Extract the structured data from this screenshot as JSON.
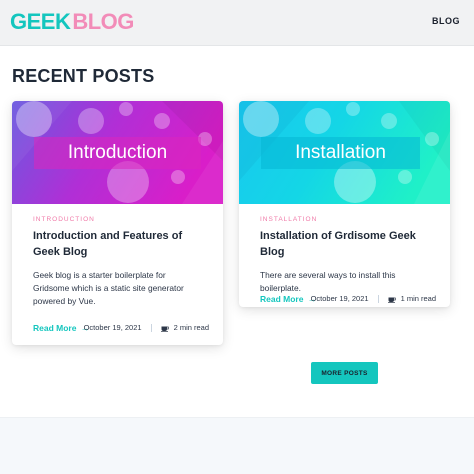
{
  "header": {
    "logo_part1": "GEEK",
    "logo_part2": "BLOG",
    "nav_blog": "BLOG"
  },
  "section_title": "RECENT POSTS",
  "posts": [
    {
      "thumb_label": "Introduction",
      "tag": "INTRODUCTION",
      "title": "Introduction and Features of Geek Blog",
      "excerpt": "Geek blog is a starter boilerplate for Gridsome which is a static site generator powered by Vue.",
      "read_more": "Read More",
      "date": "October 19, 2021",
      "read_time": "2 min read"
    },
    {
      "thumb_label": "Installation",
      "tag": "INSTALLATION",
      "title": "Installation of Grdisome Geek Blog",
      "excerpt": "There are several ways to install this boilerplate.",
      "read_more": "Read More",
      "date": "October 19, 2021",
      "read_time": "1 min read"
    }
  ],
  "more_posts_label": "MORE POSTS",
  "colors": {
    "accent": "#14c6be",
    "pink": "#f28cb8"
  }
}
